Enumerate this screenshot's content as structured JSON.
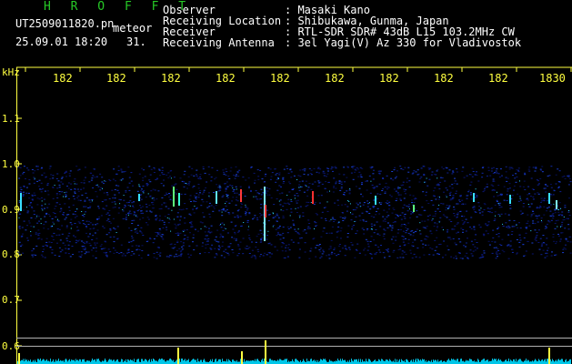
{
  "header": {
    "app_logo": "H R O F F T",
    "filename": "UT2509011820.pn",
    "category": "meteor",
    "datetime": "25.09.01 18:20",
    "count": "31.",
    "fields": [
      {
        "label": "Observer",
        "value": ": Masaki Kano"
      },
      {
        "label": "Receiving Location",
        "value": ": Shibukawa, Gunma, Japan"
      },
      {
        "label": "Receiver",
        "value": ": RTL-SDR SDR# 43dB L15 103.2MHz CW"
      },
      {
        "label": "Receiving Antenna",
        "value": ": 3el Yagi(V) Az 330 for Vladivostok"
      }
    ]
  },
  "spectrogram": {
    "y_unit": "kHz",
    "y_ticks": [
      "1.1",
      "1.0",
      "0.9",
      "0.8",
      "0.7",
      "0.6"
    ],
    "x_ticks": [
      "182",
      "182",
      "182",
      "182",
      "182",
      "182",
      "182",
      "182",
      "182",
      "1830"
    ],
    "colors": {
      "frame": "#ffff40",
      "axis_text": "#ffff40",
      "header_text": "#ffffff",
      "logo": "#26c926",
      "noise_band": "#0a1a8a",
      "activity": "#00e5ff"
    }
  }
}
